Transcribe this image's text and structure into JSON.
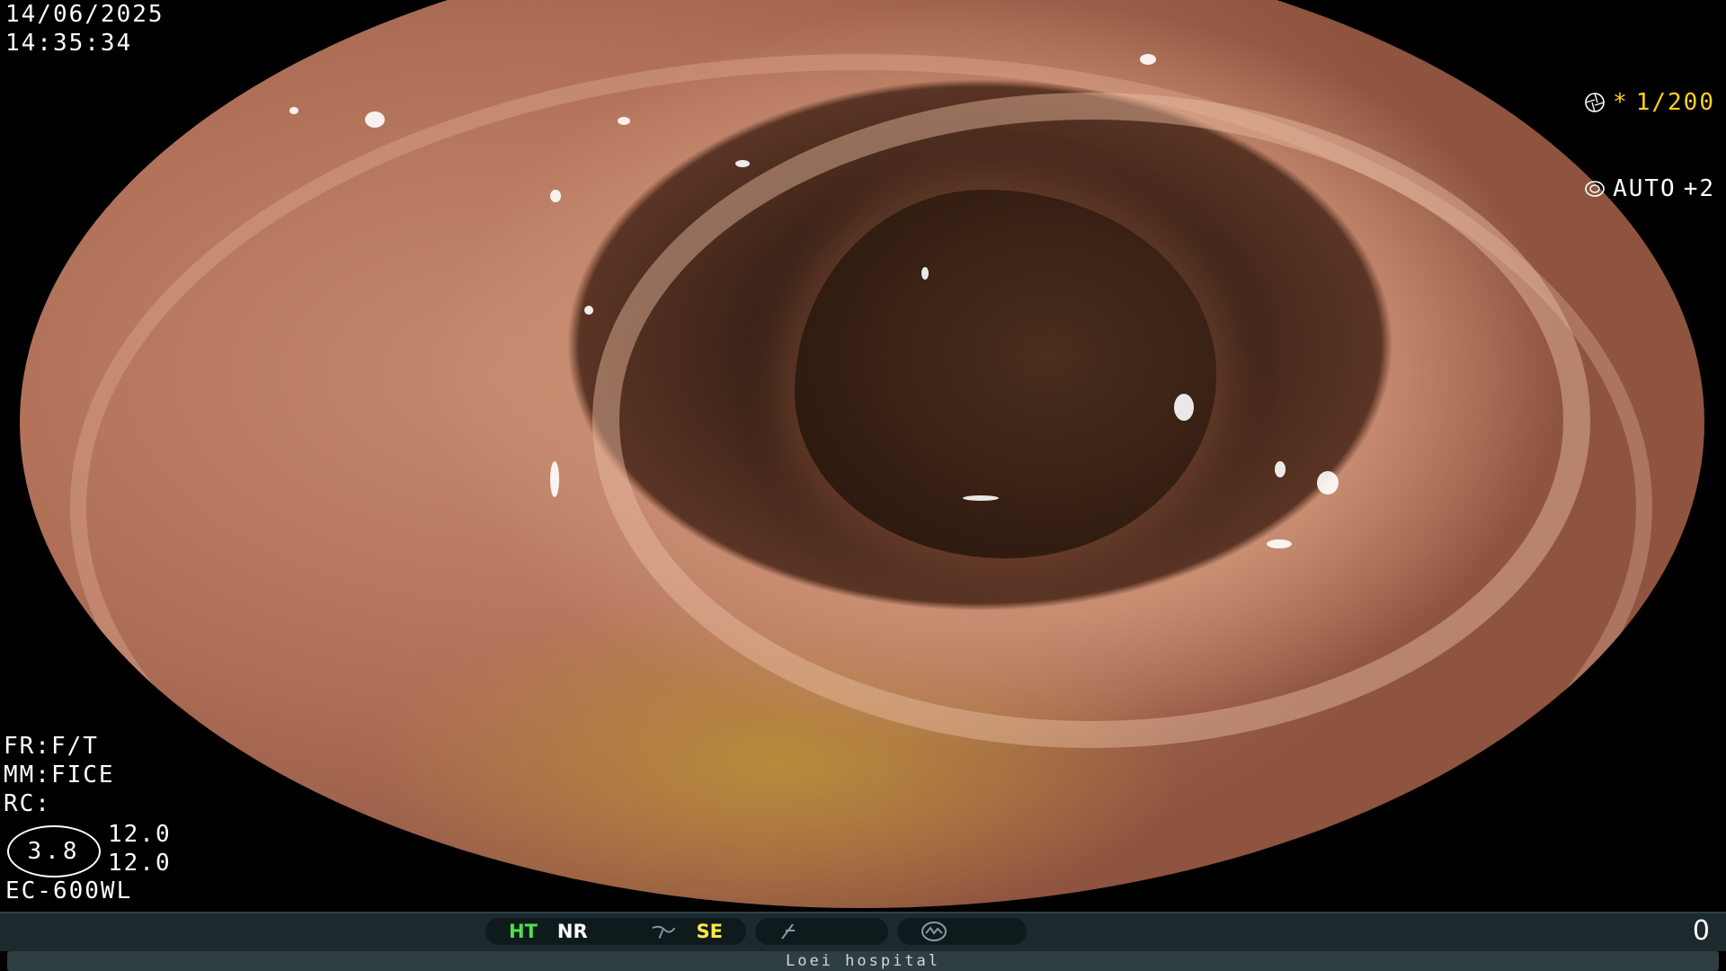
{
  "overlay": {
    "date": "14/06/2025",
    "time": "14:35:34",
    "shutter_speed": "1/200",
    "shutter_prefix": "*",
    "exposure_mode": "AUTO",
    "exposure_level": "+2",
    "fr": "FR:F/T",
    "mm": "MM:FICE",
    "rc": "RC:",
    "zoom": "3.8",
    "value_top": "12.0",
    "value_bottom": "12.0",
    "scope_model": "EC-600WL"
  },
  "status_bar": {
    "ht_label": "HT",
    "nr_label": "NR",
    "se_label": "SE",
    "counter": "0"
  },
  "footer": {
    "hospital": "Loei hospital"
  },
  "colors": {
    "accent_yellow": "#ffd21a",
    "status_green": "#4be04b",
    "status_yellow": "#ffe84a",
    "bar_background": "#1c2a2e"
  },
  "icons": {
    "shutter": "aperture-icon",
    "exposure": "iris-icon",
    "structure_enhance": "curve-icon",
    "function_slot": "slash-icon",
    "scope_mode": "scope-icon"
  }
}
